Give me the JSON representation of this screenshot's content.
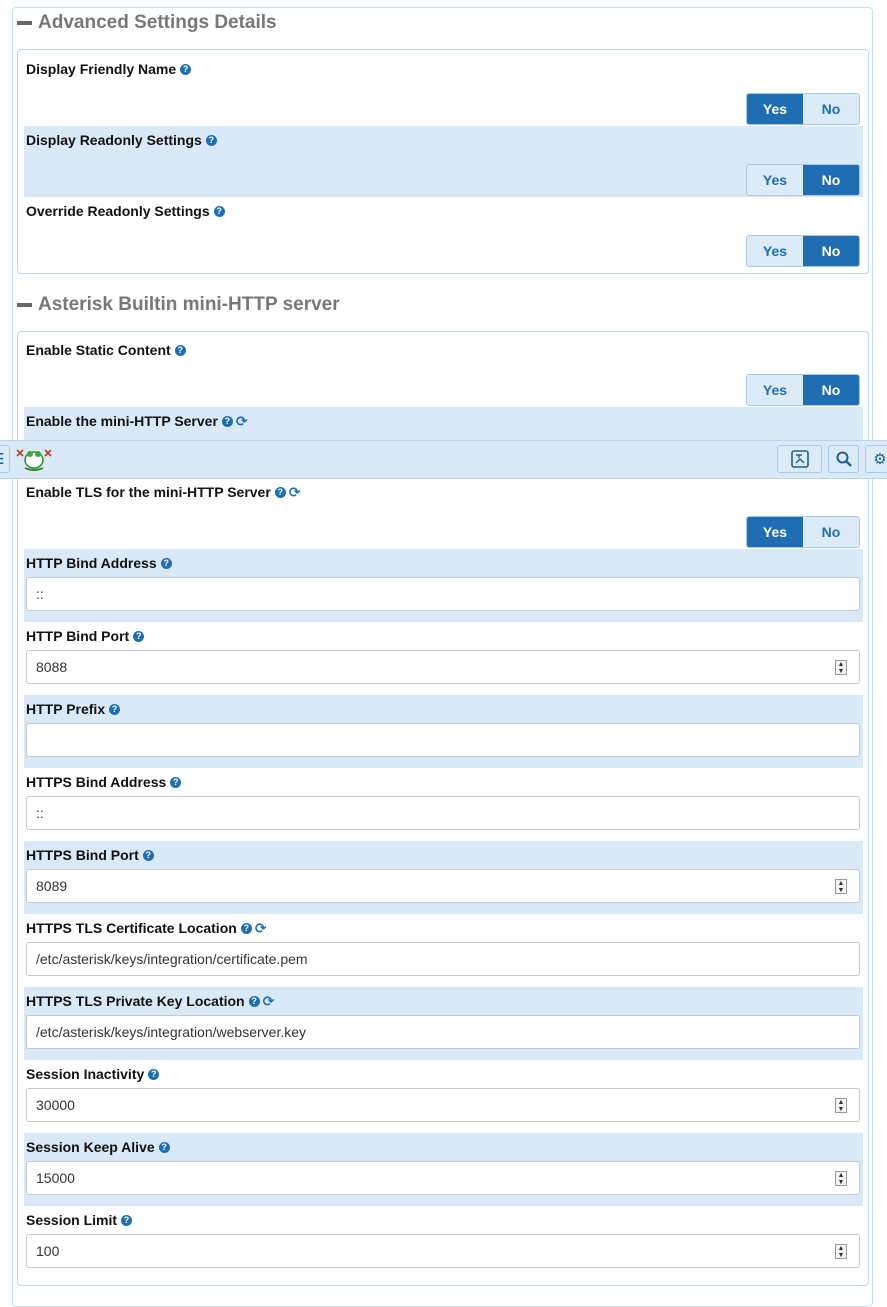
{
  "sections": [
    {
      "title": "Advanced Settings Details",
      "rows": [
        {
          "label": "Display Friendly Name",
          "type": "toggle",
          "yes": "Yes",
          "no": "No",
          "selected": "Yes"
        },
        {
          "label": "Display Readonly Settings",
          "type": "toggle",
          "yes": "Yes",
          "no": "No",
          "selected": "No"
        },
        {
          "label": "Override Readonly Settings",
          "type": "toggle",
          "yes": "Yes",
          "no": "No",
          "selected": "No"
        }
      ]
    },
    {
      "title": "Asterisk Builtin mini-HTTP server",
      "rows": [
        {
          "label": "Enable Static Content",
          "type": "toggle",
          "yes": "Yes",
          "no": "No",
          "selected": "No"
        },
        {
          "label": "Enable the mini-HTTP Server",
          "type": "toggle",
          "selected": "Yes"
        },
        {
          "label": "Enable TLS for the mini-HTTP Server",
          "type": "toggle",
          "yes": "Yes",
          "no": "No",
          "selected": "Yes"
        },
        {
          "label": "HTTP Bind Address",
          "type": "text",
          "value": "::"
        },
        {
          "label": "HTTP Bind Port",
          "type": "number",
          "value": "8088"
        },
        {
          "label": "HTTP Prefix",
          "type": "text",
          "value": ""
        },
        {
          "label": "HTTPS Bind Address",
          "type": "text",
          "value": "::"
        },
        {
          "label": "HTTPS Bind Port",
          "type": "number",
          "value": "8089"
        },
        {
          "label": "HTTPS TLS Certificate Location",
          "type": "text",
          "value": "/etc/asterisk/keys/integration/certificate.pem"
        },
        {
          "label": "HTTPS TLS Private Key Location",
          "type": "text",
          "value": "/etc/asterisk/keys/integration/webserver.key"
        },
        {
          "label": "Session Inactivity",
          "type": "number",
          "value": "30000"
        },
        {
          "label": "Session Keep Alive",
          "type": "number",
          "value": "15000"
        },
        {
          "label": "Session Limit",
          "type": "number",
          "value": "100"
        }
      ]
    }
  ],
  "icons": {
    "help": "question-circle-icon",
    "reload": "reload-icon",
    "menu": "menu-icon",
    "logo": "frog-logo-icon",
    "translate": "translate-icon",
    "search": "search-icon",
    "settings": "gear-icon"
  },
  "colors": {
    "accent": "#1f6eb3",
    "row_alt": "#d9e9f7",
    "toggle_off": "#dcebf8"
  }
}
